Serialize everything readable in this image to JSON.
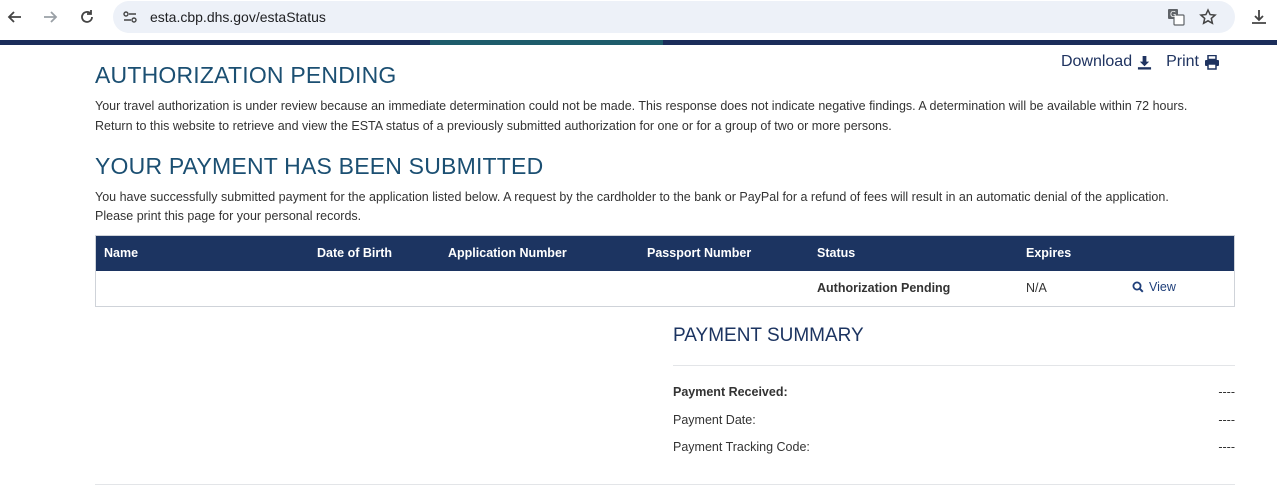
{
  "browser": {
    "url": "esta.cbp.dhs.gov/estaStatus"
  },
  "actions": {
    "download_label": "Download",
    "print_label": "Print"
  },
  "authorization": {
    "heading": "AUTHORIZATION PENDING",
    "text_line1": "Your travel authorization is under review because an immediate determination could not be made. This response does not indicate negative findings. A determination will be available within 72 hours.",
    "text_line2": "Return to this website to retrieve and view the ESTA status of a previously submitted authorization for one or for a group of two or more persons."
  },
  "payment_submitted": {
    "heading": "YOUR PAYMENT HAS BEEN SUBMITTED",
    "text_line1": "You have successfully submitted payment for the application listed below. A request by the cardholder to the bank or PayPal for a refund of fees will result in an automatic denial of the application.",
    "text_line2": "Please print this page for your personal records."
  },
  "table": {
    "headers": {
      "name": "Name",
      "dob": "Date of Birth",
      "application_number": "Application Number",
      "passport_number": "Passport Number",
      "status": "Status",
      "expires": "Expires"
    },
    "rows": [
      {
        "name": "",
        "dob": "",
        "application_number": "",
        "passport_number": "",
        "status": "Authorization Pending",
        "expires": "N/A",
        "view_label": "View"
      }
    ]
  },
  "payment_summary": {
    "title": "PAYMENT SUMMARY",
    "received_label": "Payment Received:",
    "received_value": "----",
    "date_label": "Payment Date:",
    "date_value": "----",
    "tracking_label": "Payment Tracking Code:",
    "tracking_value": "----"
  },
  "colors": {
    "header_navy": "#1c3461",
    "heading_teal": "#1b4f72"
  }
}
